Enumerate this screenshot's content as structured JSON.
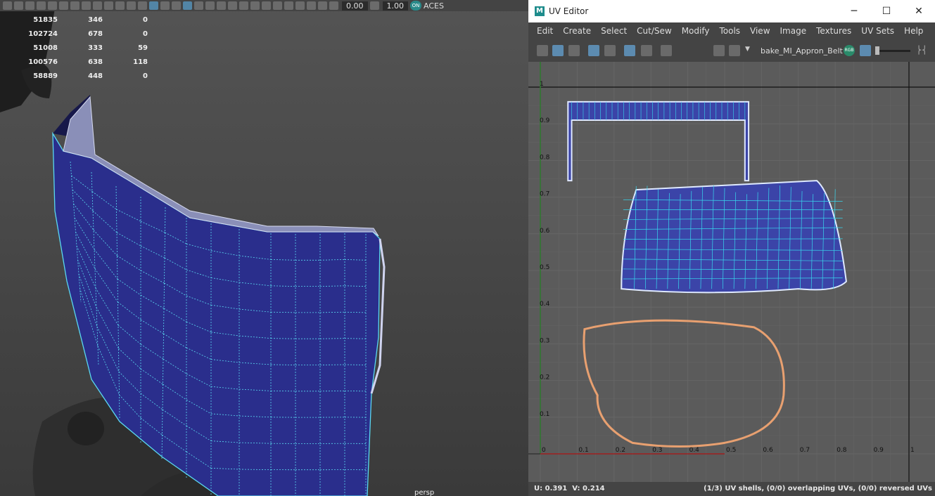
{
  "viewport": {
    "toolbar": {
      "value1": "0.00",
      "value2": "1.00",
      "color_space": "ACES",
      "toggle_on_label": "ON"
    },
    "hud_rows": [
      [
        "51835",
        "346",
        "0"
      ],
      [
        "102724",
        "678",
        "0"
      ],
      [
        "51008",
        "333",
        "59"
      ],
      [
        "100576",
        "638",
        "118"
      ],
      [
        "58889",
        "448",
        "0"
      ]
    ],
    "camera": "persp",
    "mesh_color": "#2a2e8c",
    "wire_color": "#5ad8f0"
  },
  "uv_editor": {
    "title": "UV Editor",
    "app_icon": "M",
    "window_buttons": {
      "minimize": "─",
      "maximize": "☐",
      "close": "✕"
    },
    "menu": [
      "Edit",
      "Create",
      "Select",
      "Cut/Sew",
      "Modify",
      "Tools",
      "View",
      "Image",
      "Textures",
      "UV Sets",
      "Help"
    ],
    "texture_name": "bake_MI_Appron_Belt",
    "rgb_label": "RGB",
    "y_ticks": [
      "1",
      "0.9",
      "0.8",
      "0.7",
      "0.6",
      "0.5",
      "0.4",
      "0.3",
      "0.2",
      "0.1"
    ],
    "x_ticks": [
      "0",
      "0.1",
      "0.2",
      "0.3",
      "0.4",
      "0.5",
      "0.6",
      "0.7",
      "0.8",
      "0.9",
      "1"
    ],
    "status": {
      "u_label": "U:",
      "u_value": "0.391",
      "v_label": "V:",
      "v_value": "0.214",
      "summary": "(1/3) UV shells, (0/0) overlapping UVs, (0/0) reversed UVs"
    },
    "colors": {
      "shell_fill": "#3b44a8",
      "shell_edge": "#38d8ee",
      "unselected_shell": "#e8a070",
      "canvas_bg": "#5b5b5b"
    }
  }
}
